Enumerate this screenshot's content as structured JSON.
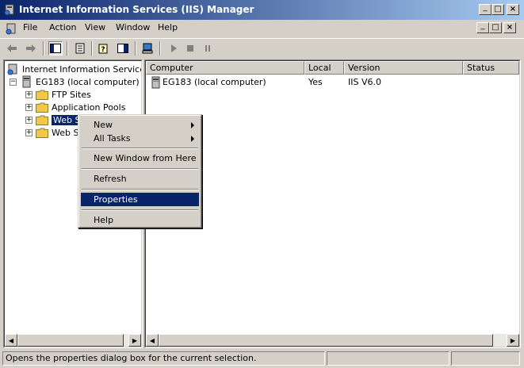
{
  "window": {
    "title": "Internet Information Services (IIS) Manager",
    "caption_minimize": "_",
    "caption_maximize": "□",
    "caption_close": "×"
  },
  "menubar": {
    "items": [
      "File",
      "Action",
      "View",
      "Window",
      "Help"
    ]
  },
  "toolbar": {
    "buttons": [
      "back",
      "forward",
      "show-hide-console-tree",
      "export-list",
      "help",
      "show-hide-action-pane",
      "connect-computer",
      "start",
      "stop",
      "pause"
    ]
  },
  "tree": {
    "root": "Internet Information Services",
    "computer": "EG183 (local computer)",
    "children": [
      "FTP Sites",
      "Application Pools",
      "Web Sites",
      "Web Service Extensions"
    ],
    "visible_children": [
      "FTP Sites",
      "Application Pools",
      "Web S",
      "Web S"
    ],
    "selected": "Web Sites"
  },
  "list": {
    "columns": [
      "Computer",
      "Local",
      "Version",
      "Status"
    ],
    "rows": [
      {
        "computer": "EG183 (local computer)",
        "local": "Yes",
        "version": "IIS V6.0",
        "status": ""
      }
    ]
  },
  "context_menu": {
    "items": [
      {
        "label": "New",
        "submenu": true
      },
      {
        "label": "All Tasks",
        "submenu": true
      },
      {
        "label": "New Window from Here",
        "submenu": false
      },
      {
        "label": "Refresh",
        "submenu": false
      },
      {
        "label": "Properties",
        "submenu": false,
        "highlighted": true
      },
      {
        "label": "Help",
        "submenu": false
      }
    ]
  },
  "statusbar": {
    "text": "Opens the properties dialog box for the current selection."
  },
  "colors": {
    "title_start": "#0a246a",
    "title_end": "#a6caf0",
    "face": "#d4d0c8",
    "highlight": "#0a246a",
    "folder": "#f0c850"
  }
}
